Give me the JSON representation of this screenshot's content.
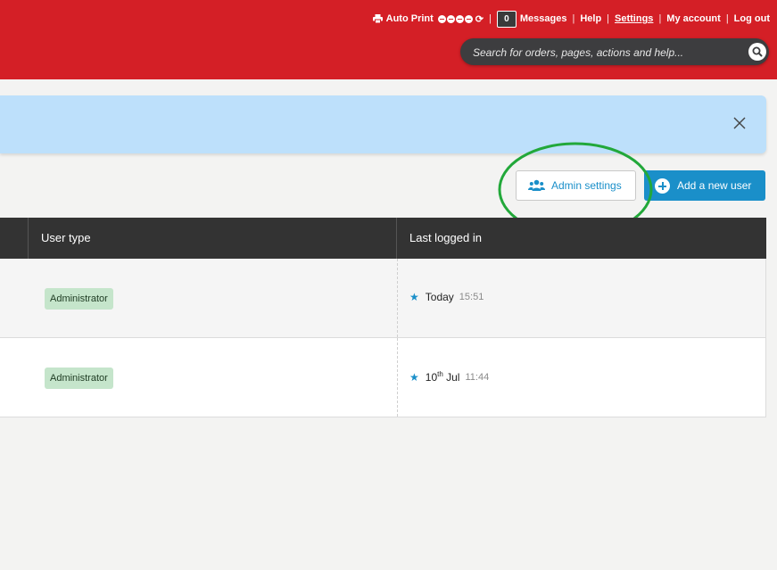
{
  "header": {
    "auto_print_label": "Auto Print",
    "messages_count": "0",
    "messages_label": "Messages",
    "help_label": "Help",
    "settings_label": "Settings",
    "my_account_label": "My account",
    "log_out_label": "Log out",
    "brand_color": "#d41f26"
  },
  "search": {
    "placeholder": "Search for orders, pages, actions and help..."
  },
  "actions": {
    "admin_settings_label": "Admin settings",
    "add_user_label": "Add a new user",
    "accent_color": "#1a8fc9"
  },
  "table": {
    "columns": [
      "User type",
      "Last logged in"
    ],
    "rows": [
      {
        "user_type": "Administrator",
        "date_main": "Today",
        "date_sup": "",
        "date_rest": "",
        "time": "15:51"
      },
      {
        "user_type": "Administrator",
        "date_main": "10",
        "date_sup": "th",
        "date_rest": " Jul",
        "time": "11:44"
      }
    ]
  }
}
